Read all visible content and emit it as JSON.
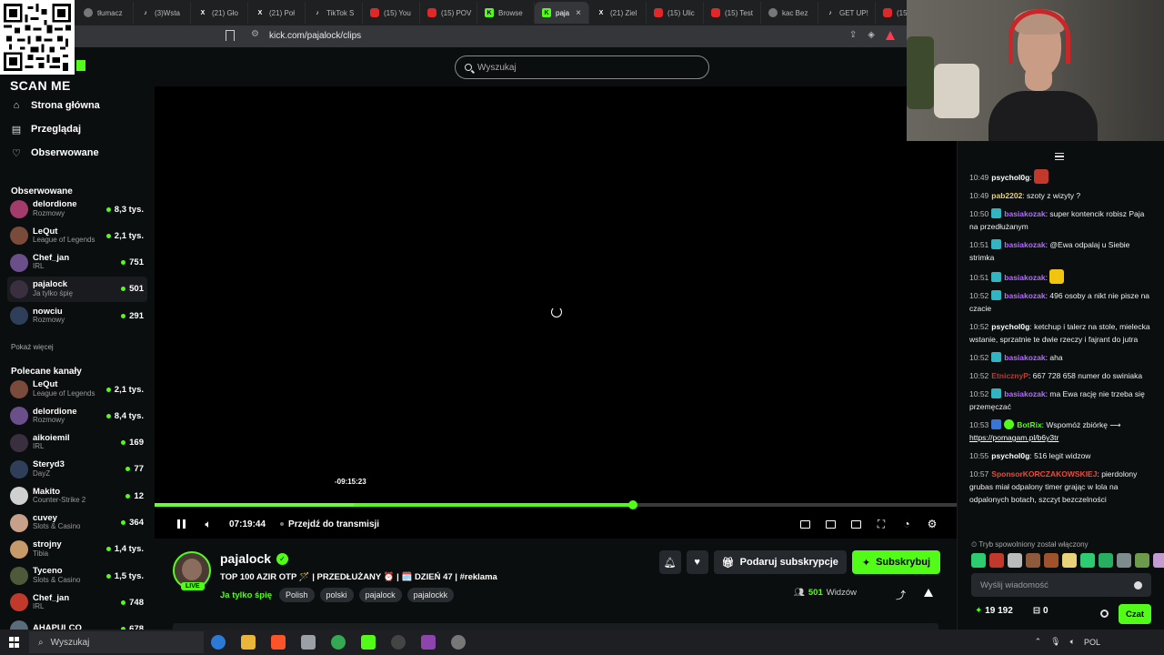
{
  "browser": {
    "tabs": [
      {
        "label": "tłumacz",
        "icon": "google-icon",
        "active": false
      },
      {
        "label": "(3)Wsta",
        "icon": "tiktok-icon",
        "active": false
      },
      {
        "label": "(21) Gło",
        "icon": "x-icon",
        "active": false
      },
      {
        "label": "(21) Poł",
        "icon": "x-icon",
        "active": false
      },
      {
        "label": "TikTok S",
        "icon": "tiktok-icon",
        "active": false
      },
      {
        "label": "(15) You",
        "icon": "youtube-icon",
        "active": false
      },
      {
        "label": "(15) POV",
        "icon": "youtube-icon",
        "active": false
      },
      {
        "label": "Browse",
        "icon": "kick-icon",
        "active": false
      },
      {
        "label": "paja",
        "icon": "kick-icon",
        "active": true
      },
      {
        "label": "(21) Ziel",
        "icon": "x-icon",
        "active": false
      },
      {
        "label": "(15) Ulic",
        "icon": "youtube-icon",
        "active": false
      },
      {
        "label": "(15) Test",
        "icon": "youtube-icon",
        "active": false
      },
      {
        "label": "kac Bez",
        "icon": "google-icon",
        "active": false
      },
      {
        "label": "GET UP!",
        "icon": "tiktok-icon",
        "active": false
      },
      {
        "label": "(15) Je",
        "icon": "youtube-icon",
        "active": false
      }
    ],
    "url": "kick.com/pajalock/clips"
  },
  "overlay": {
    "scan_me": "SCAN ME"
  },
  "search": {
    "placeholder": "Wyszukaj"
  },
  "sidebar": {
    "nav": [
      {
        "label": "Strona główna",
        "icon": "home-icon"
      },
      {
        "label": "Przeglądaj",
        "icon": "browse-icon"
      },
      {
        "label": "Obserwowane",
        "icon": "heart-icon"
      }
    ],
    "followed_title": "Obserwowane",
    "followed": [
      {
        "name": "delordione",
        "category": "Rozmowy",
        "viewers": "8,3 tys."
      },
      {
        "name": "LeQut",
        "category": "League of Legends",
        "viewers": "2,1 tys."
      },
      {
        "name": "Chef_jan",
        "category": "IRL",
        "viewers": "751"
      },
      {
        "name": "pajalock",
        "category": "Ja tylko śpię",
        "viewers": "501"
      },
      {
        "name": "nowciu",
        "category": "Rozmowy",
        "viewers": "291"
      }
    ],
    "show_more": "Pokaż więcej",
    "recommended_title": "Polecane kanały",
    "recommended": [
      {
        "name": "LeQut",
        "category": "League of Legends",
        "viewers": "2,1 tys."
      },
      {
        "name": "delordione",
        "category": "Rozmowy",
        "viewers": "8,4 tys."
      },
      {
        "name": "aikoiemil",
        "category": "IRL",
        "viewers": "169"
      },
      {
        "name": "Steryd3",
        "category": "DayZ",
        "viewers": "77"
      },
      {
        "name": "Makito",
        "category": "Counter-Strike 2",
        "viewers": "12"
      },
      {
        "name": "cuvey",
        "category": "Slots & Casino",
        "viewers": "364"
      },
      {
        "name": "strojny",
        "category": "Tibia",
        "viewers": "1,4 tys."
      },
      {
        "name": "Tyceno",
        "category": "Slots & Casino",
        "viewers": "1,5 tys."
      },
      {
        "name": "Chef_jan",
        "category": "IRL",
        "viewers": "748"
      },
      {
        "name": "AHAPULCO",
        "category": "",
        "viewers": "678"
      }
    ]
  },
  "player": {
    "seek_tooltip": "-09:15:23",
    "progress_fraction": 0.596,
    "hover_fraction": 0.248,
    "current_time": "07:19:44",
    "go_live": "Przejdź do transmisji"
  },
  "stream": {
    "name": "pajalock",
    "live_badge": "LIVE",
    "title": "TOP 100 AZIR OTP 🪄 | PRZEDŁUŻANY ⏰ | 🗓️ DZIEŃ 47 | #reklama",
    "category": "Ja tylko śpię",
    "tags": [
      "Polish",
      "polski",
      "pajalock",
      "pajalockk"
    ],
    "gift_label": "Podaruj subskrypcje",
    "subscribe_label": "Subskrybuj",
    "viewer_count": "501",
    "viewers_label": "Widzów"
  },
  "chat": {
    "messages": [
      {
        "time": "10:49",
        "user": "psychol0g",
        "color": "#ffffff",
        "badge": "",
        "text": "",
        "emote": "#c0392b"
      },
      {
        "time": "10:49",
        "user": "pab2202",
        "color": "#e8d27a",
        "badge": "",
        "text": "szoty z wizyty ?",
        "emote": ""
      },
      {
        "time": "10:50",
        "user": "basiakozak",
        "color": "#b46cff",
        "badge": "sub",
        "text": "super kontencik robisz Paja na przedłużanym",
        "emote": ""
      },
      {
        "time": "10:51",
        "user": "basiakozak",
        "color": "#b46cff",
        "badge": "sub",
        "text": "@Ewa odpalaj u Siebie strimka",
        "emote": ""
      },
      {
        "time": "10:51",
        "user": "basiakozak",
        "color": "#b46cff",
        "badge": "sub",
        "text": "",
        "emote": "#f1c40f"
      },
      {
        "time": "10:52",
        "user": "basiakozak",
        "color": "#b46cff",
        "badge": "sub",
        "text": "496 osoby a nikt nie pisze na czacie",
        "emote": ""
      },
      {
        "time": "10:52",
        "user": "psychol0g",
        "color": "#ffffff",
        "badge": "",
        "text": "ketchup i talerz na stole, mielecka wstanie, sprzatnie te dwie rzeczy i fajrant do jutra",
        "emote": ""
      },
      {
        "time": "10:52",
        "user": "basiakozak",
        "color": "#b46cff",
        "badge": "sub",
        "text": "aha",
        "emote": ""
      },
      {
        "time": "10:52",
        "user": "EtnicznyP",
        "color": "#c0392b",
        "badge": "",
        "text": "667 728 658 numer do swiniaka",
        "emote": ""
      },
      {
        "time": "10:52",
        "user": "basiakozak",
        "color": "#b46cff",
        "badge": "sub",
        "text": "ma Ewa rację nie trzeba się przemęczać",
        "emote": ""
      },
      {
        "time": "10:53",
        "user": "BotRix",
        "color": "#53fc18",
        "badge": "bot",
        "text": "Wspomóż zbiórkę ⟶",
        "link": "https://pomagam.pl/b6y3tr",
        "emote": ""
      },
      {
        "time": "10:55",
        "user": "psychol0g",
        "color": "#ffffff",
        "badge": "",
        "text": "516 legit widzow",
        "emote": ""
      },
      {
        "time": "10:57",
        "user": "SponsorKORCZAKOWSKIEJ",
        "color": "#e74c3c",
        "badge": "",
        "text": "pierdolony grubas miał odpalony timer grając w lola na odpalonych botach, szczyt bezczelności",
        "emote": ""
      }
    ],
    "slow_mode": "Tryb spowolniony został włączony",
    "input_placeholder": "Wyślij wiadomość",
    "kicks": "19 192",
    "gifts": "0",
    "chat_button": "Czat"
  },
  "taskbar": {
    "search_placeholder": "Wyszukaj",
    "lang": "POL"
  },
  "colors": {
    "accent": "#53fc18",
    "page_bg": "#0b0e0f"
  }
}
